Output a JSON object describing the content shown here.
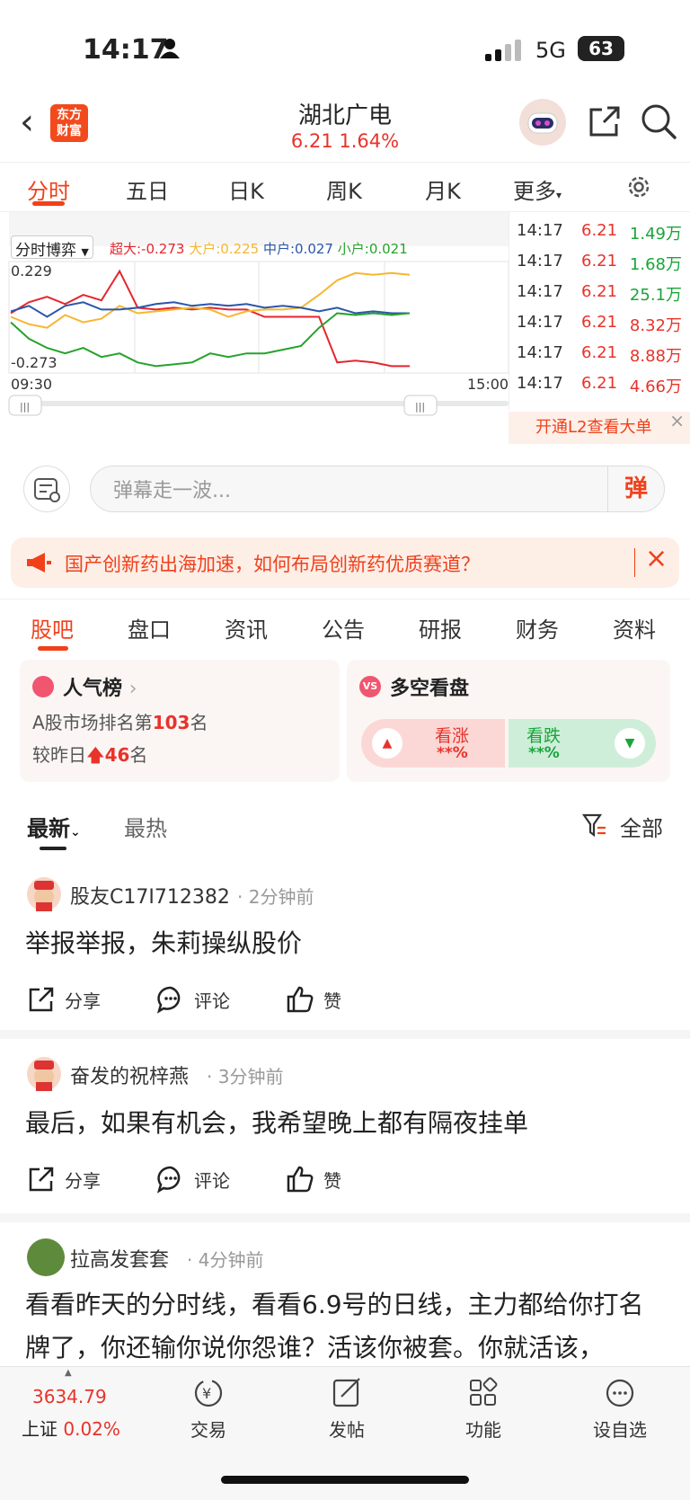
{
  "status_bar": {
    "time": "14:17",
    "network": "5G",
    "battery": "63"
  },
  "header": {
    "back": "‹",
    "logo_line1": "东方",
    "logo_line2": "财富",
    "title": "湖北广电",
    "price_line": "6.21  1.64%"
  },
  "chart_tabs": [
    "分时",
    "五日",
    "日K",
    "周K",
    "月K",
    "更多"
  ],
  "chart": {
    "indicator_label": "分时博弈",
    "legend": [
      {
        "text": "超大:-0.273",
        "color": "#e5262d"
      },
      {
        "text": "大户:0.225",
        "color": "#f7b630"
      },
      {
        "text": "中户:0.027",
        "color": "#2c56a8"
      },
      {
        "text": "小户:0.021",
        "color": "#25a32b"
      }
    ],
    "y_top": "0.229",
    "y_bottom": "-0.273",
    "x_start": "09:30",
    "x_end": "15:00"
  },
  "chart_data": {
    "type": "line",
    "title": "",
    "xlabel": "",
    "ylabel": "",
    "x_range": [
      "09:30",
      "15:00"
    ],
    "ylim": [
      -0.273,
      0.229
    ],
    "series": [
      {
        "name": "超大",
        "color": "#e5262d",
        "values": [
          0.02,
          0.08,
          0.11,
          0.07,
          0.12,
          0.09,
          0.25,
          0.05,
          0.04,
          0.05,
          0.04,
          0.05,
          0.04,
          0.04,
          0.0,
          0.0,
          0.0,
          0.0,
          -0.25,
          -0.24,
          -0.25,
          -0.27,
          -0.27
        ]
      },
      {
        "name": "大户",
        "color": "#f7b630",
        "values": [
          0.0,
          -0.04,
          -0.06,
          0.01,
          -0.03,
          -0.01,
          0.06,
          0.02,
          0.03,
          0.04,
          0.05,
          0.04,
          0.0,
          0.03,
          0.04,
          0.04,
          0.05,
          0.12,
          0.2,
          0.24,
          0.23,
          0.24,
          0.23
        ]
      },
      {
        "name": "中户",
        "color": "#2c56a8",
        "values": [
          0.03,
          0.06,
          0.0,
          0.06,
          0.08,
          0.04,
          0.04,
          0.05,
          0.07,
          0.08,
          0.06,
          0.07,
          0.06,
          0.07,
          0.05,
          0.06,
          0.05,
          0.03,
          0.05,
          0.02,
          0.03,
          0.02,
          0.02
        ]
      },
      {
        "name": "小户",
        "color": "#25a32b",
        "values": [
          -0.03,
          -0.12,
          -0.17,
          -0.2,
          -0.17,
          -0.22,
          -0.2,
          -0.25,
          -0.27,
          -0.26,
          -0.25,
          -0.2,
          -0.22,
          -0.2,
          -0.2,
          -0.18,
          -0.16,
          -0.06,
          0.02,
          0.01,
          0.02,
          0.01,
          0.02
        ]
      }
    ],
    "grid": true
  },
  "quotes": [
    {
      "time": "14:17",
      "price": "6.21",
      "vol": "1.49万",
      "vol_color": "#1aa53a"
    },
    {
      "time": "14:17",
      "price": "6.21",
      "vol": "1.68万",
      "vol_color": "#1aa53a"
    },
    {
      "time": "14:17",
      "price": "6.21",
      "vol": "25.1万",
      "vol_color": "#1aa53a"
    },
    {
      "time": "14:17",
      "price": "6.21",
      "vol": "8.32万",
      "vol_color": "#e8332a"
    },
    {
      "time": "14:17",
      "price": "6.21",
      "vol": "8.88万",
      "vol_color": "#e8332a"
    },
    {
      "time": "14:17",
      "price": "6.21",
      "vol": "4.66万",
      "vol_color": "#e8332a"
    }
  ],
  "l2_banner": "开通L2查看大单",
  "danmu": {
    "placeholder": "弹幕走一波...",
    "button": "弹"
  },
  "notice": {
    "text": "国产创新药出海加速，如何布局创新药优质赛道？"
  },
  "section_tabs": [
    "股吧",
    "盘口",
    "资讯",
    "公告",
    "研报",
    "财务",
    "资料"
  ],
  "popularity": {
    "title": "人气榜",
    "rank_prefix": "A股市场排名第",
    "rank": "103",
    "rank_suffix": "名",
    "change_prefix": "较昨日",
    "change": "46",
    "change_suffix": "名"
  },
  "bull_bear": {
    "title": "多空看盘",
    "bull_label": "看涨",
    "bull_value": "**%",
    "bear_label": "看跌",
    "bear_value": "**%"
  },
  "sort": {
    "latest": "最新",
    "hot": "最热",
    "filter": "全部"
  },
  "posts": [
    {
      "author": "股友C17I712382",
      "time": "2分钟前",
      "text": "举报举报，朱莉操纵股价",
      "share": "分享",
      "comment": "评论",
      "like": "赞"
    },
    {
      "author": "奋发的祝梓燕",
      "time": "3分钟前",
      "text": "最后，如果有机会，我希望晚上都有隔夜挂单",
      "share": "分享",
      "comment": "评论",
      "like": "赞"
    },
    {
      "author": "拉高发套套",
      "time": "4分钟前",
      "text": "看看昨天的分时线，看看6.9号的日线，主力都给你打名牌了，你还输你说你怨谁？活该你被套。你就活该，"
    }
  ],
  "bottom_nav": {
    "index_value": "3634.79",
    "index_name": "上证",
    "index_change": "0.02%",
    "items": [
      "交易",
      "发帖",
      "功能",
      "设自选"
    ]
  }
}
